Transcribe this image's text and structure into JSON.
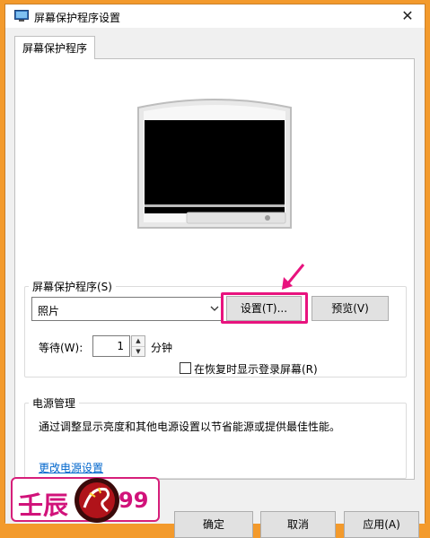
{
  "window": {
    "title": "屏幕保护程序设置",
    "close_glyph": "✕"
  },
  "tab": {
    "label": "屏幕保护程序"
  },
  "screensaver": {
    "group_label": "屏幕保护程序(S)",
    "selected": "照片",
    "settings_button": "设置(T)...",
    "preview_button": "预览(V)",
    "wait_label": "等待(W):",
    "wait_value": "1",
    "wait_unit": "分钟",
    "resume_checkbox_label": "在恢复时显示登录屏幕(R)",
    "resume_checked": false
  },
  "power": {
    "group_label": "电源管理",
    "description": "通过调整显示亮度和其他电源设置以节省能源或提供最佳性能。",
    "link": "更改电源设置"
  },
  "footer": {
    "ok": "确定",
    "cancel": "取消",
    "apply": "应用(A)"
  },
  "watermark": {
    "text_left": "壬辰",
    "text_right": "99"
  },
  "colors": {
    "frame": "#f39a2c",
    "highlight": "#e8137e",
    "link": "#0066cc"
  }
}
